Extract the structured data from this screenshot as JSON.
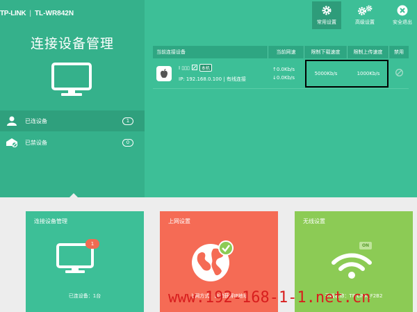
{
  "header": {
    "brand": "TP-LINK",
    "separator": "|",
    "model": "TL-WR842N"
  },
  "sidebar": {
    "title": "连接设备管理",
    "items": [
      {
        "label": "已连设备",
        "count": "1"
      },
      {
        "label": "已禁设备",
        "count": "0"
      }
    ]
  },
  "toolbar": {
    "common": "常用设置",
    "advanced": "高级设置",
    "logout": "安全退出"
  },
  "table": {
    "headers": [
      "当前连接设备",
      "当前网速",
      "限制下载速度",
      "限制上传速度",
      "禁用"
    ],
    "rows": [
      {
        "device_name": "I ▯▯▯",
        "tag": "本机",
        "ip_line": "IP: 192.168.0.100 | 有线连接",
        "up_speed": "↑0.0Kb/s",
        "down_speed": "↓0.0Kb/s",
        "limit_down": "5000Kb/s",
        "limit_up": "1000Kb/s"
      }
    ]
  },
  "cards": [
    {
      "title": "连接设备管理",
      "badge": "1",
      "footer": "已连设备：1台"
    },
    {
      "title": "上网设置",
      "footer": "上网方式：自动获得IP地址"
    },
    {
      "title": "无线设置",
      "on_label": "ON",
      "footer": "无线名称：TP-LINK_F2B2"
    }
  ],
  "watermark": "www.192-168-1-1.net.cn",
  "colors": {
    "green": "#3dbf97",
    "green_dark": "#35b18b",
    "orange": "#f56b55",
    "lime": "#8ccb55",
    "watermark": "#d81e1e"
  }
}
